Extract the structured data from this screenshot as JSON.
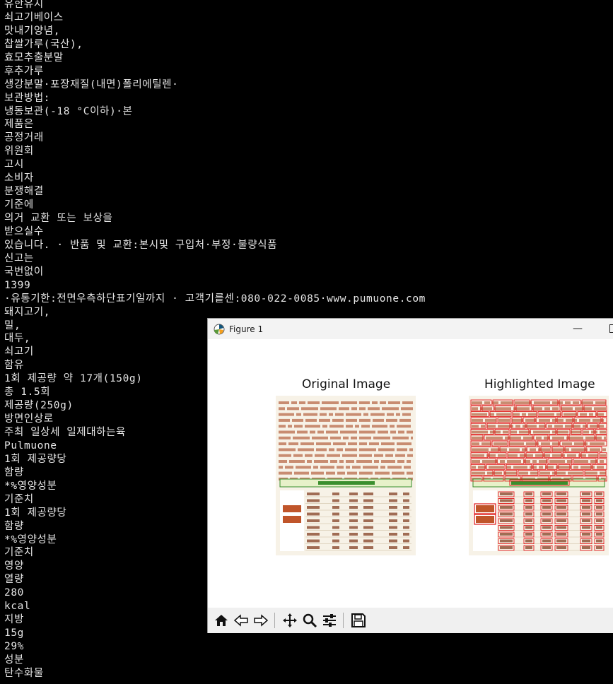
{
  "terminal": {
    "lines": [
      "유한유지",
      "쇠고기베이스",
      "맛내기양념,",
      "찹쌀가루(국산),",
      "효모추출분말",
      "후추가루",
      "생강분말·포장재질(내면)폴리에틸렌·",
      "보관방법:",
      "냉동보관(-18 °C이하)·본",
      "제품은",
      "공정거래",
      "위원회",
      "고시",
      "소비자",
      "분쟁해결",
      "기준에",
      "의거 교환 또는 보상을",
      "받으실수",
      "있습니다. · 반품 및 교환:본시및 구입처·부정·불량식품",
      "신고는",
      "국번없이",
      "1399",
      "·유통기한:전면우측하단표기일까지 · 고객기릍센:080-022-0085·www.pumuone.com",
      "돼지고기,",
      "밀,",
      "대두,",
      "쇠고기",
      "함유",
      "1회 제공량 약 17개(150g)",
      "총 1.5회",
      "제공량(250g)",
      "방면인상로",
      "주최 일상세 일제대하는육",
      "Pulmuone",
      "1회 제공량당",
      "함량",
      "*%영양성분",
      "기준치",
      "1회 제공량당",
      "함량",
      "*%영양성분",
      "기준치",
      "영양",
      "열량",
      "280",
      "kcal",
      "지방",
      "15g",
      "29%",
      "성분",
      "탄수화물"
    ]
  },
  "figure": {
    "window_title": "Figure 1",
    "left_subplot_title": "Original Image",
    "right_subplot_title": "Highlighted Image",
    "box_color": "#e01818",
    "accent_green": "#3a8f2e"
  },
  "toolbar": {
    "icons": [
      "home-icon",
      "back-icon",
      "forward-icon",
      "pan-icon",
      "zoom-icon",
      "configure-icon",
      "save-icon"
    ]
  }
}
